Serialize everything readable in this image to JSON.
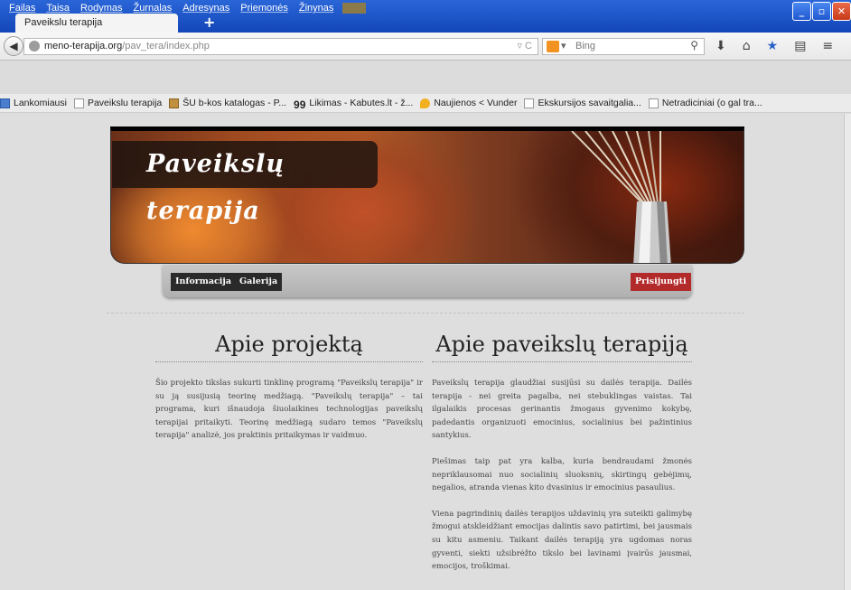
{
  "menubar": {
    "items": [
      "Failas",
      "Taisa",
      "Rodymas",
      "Žurnalas",
      "Adresynas",
      "Priemonės",
      "Žinynas"
    ]
  },
  "tab": {
    "title": "Paveikslu terapija",
    "new_tab": "+"
  },
  "navbar": {
    "url_host": "meno-terapija.org",
    "url_path": "/pav_tera/index.php",
    "url_controls": "▿ C",
    "search_placeholder": "Bing",
    "search_engine_arrow": "▾"
  },
  "bookmarks": [
    {
      "label": "Lankomiausi",
      "icon": "blue"
    },
    {
      "label": "Paveikslu terapija",
      "icon": "page"
    },
    {
      "label": "ŠU b-kos katalogas - P...",
      "icon": "img"
    },
    {
      "label": "Likimas - Kabutes.lt - ž...",
      "icon": "quote",
      "glyph": "99"
    },
    {
      "label": "Naujienos < Vunder",
      "icon": "drop"
    },
    {
      "label": "Ekskursijos savaitgalia...",
      "icon": "page"
    },
    {
      "label": "Netradiciniai (o gal tra...",
      "icon": "page"
    }
  ],
  "site": {
    "title": "Paveikslų terapija",
    "nav": {
      "info": "Informacija",
      "gallery": "Galerija",
      "login": "Prisijungti"
    },
    "left": {
      "heading": "Apie projektą",
      "p1": "Šio projekto tikslas sukurti tinklinę programą \"Paveikslų terapija\" ir su ją susijusią teorinę medžiagą. \"Paveikslų terapija\" – tai programa, kuri išnaudoja šiuolaikines technologijas paveikslų terapijai pritaikyti. Teorinę medžiagą sudaro temos \"Paveikslų terapija\" analizė, jos praktinis pritaikymas ir vaidmuo."
    },
    "right": {
      "heading": "Apie paveikslų terapiją",
      "p1": "Paveikslų terapija glaudžiai susijūsi su dailės terapija. Dailės terapija - nei greita pagalba, nei stebuklingas vaistas. Tai ilgalaikis procesas gerinantis žmogaus gyvenimo kokybę, padedantis organizuoti emocinius, socialinius bei pažintinius santykius.",
      "p2": "Piešimas taip pat yra kalba, kuria bendraudami žmonės nepriklausomai nuo socialinių sluoksnių, skirtingų gebėjimų, negalios, atranda vienas kito dvasinius ir emocinius pasaulius.",
      "p3": "Viena pagrindinių dailės terapijos uždavinių yra suteikti galimybę žmogui atskleidžiant emocijas dalintis savo patirtimi, bei jausmais su kitu asmeniu. Taikant dailės terapiją yra ugdomas noras gyventi, siekti užsibrėžto tikslo bei lavinami įvairūs jausmai, emocijos, troškimai."
    }
  }
}
